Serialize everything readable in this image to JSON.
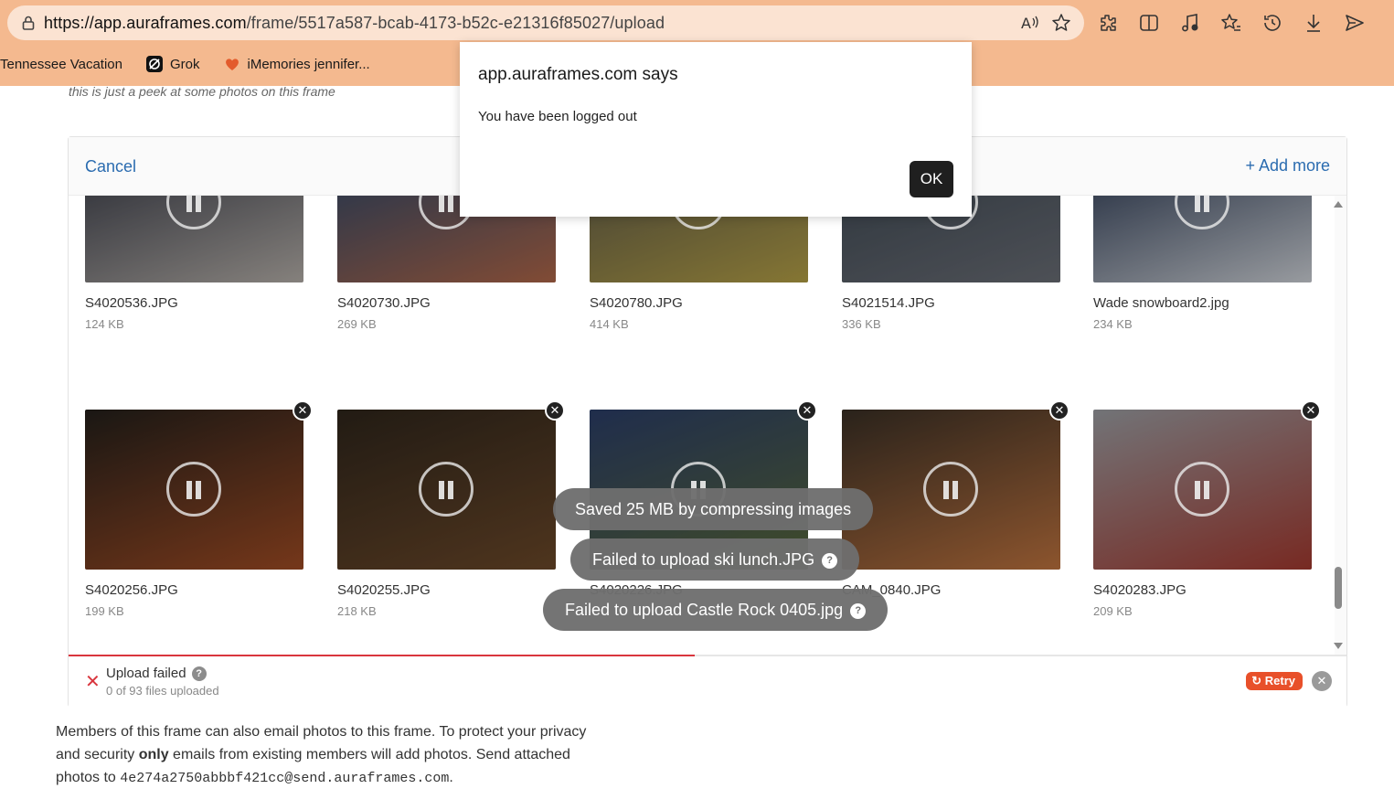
{
  "browser": {
    "url_host": "https://app.auraframes.com",
    "url_path": "/frame/5517a587-bcab-4173-b52c-e21316f85027/upload",
    "bookmarks": [
      {
        "label": "Tennessee Vacation"
      },
      {
        "label": "Grok"
      },
      {
        "label": "iMemories jennifer..."
      }
    ]
  },
  "page": {
    "peek_text": "this is just a peek at some photos on this frame"
  },
  "uploader": {
    "cancel_label": "Cancel",
    "add_more_label": "+ Add more",
    "rows": [
      [
        {
          "name": "S4020536.JPG",
          "size": "124 KB",
          "colors": [
            "#3b3e4a",
            "#b9b3ad"
          ]
        },
        {
          "name": "S4020730.JPG",
          "size": "269 KB",
          "colors": [
            "#314a6b",
            "#b4694a"
          ]
        },
        {
          "name": "S4020780.JPG",
          "size": "414 KB",
          "colors": [
            "#5e5a4c",
            "#b9a447"
          ]
        },
        {
          "name": "S4021514.JPG",
          "size": "336 KB",
          "colors": [
            "#3f4a55",
            "#6c7078"
          ]
        },
        {
          "name": "Wade snowboard2.jpg",
          "size": "234 KB",
          "colors": [
            "#2f3d57",
            "#d3d7dd"
          ]
        }
      ],
      [
        {
          "name": "S4020256.JPG",
          "size": "199 KB",
          "colors": [
            "#24201c",
            "#a34d24"
          ]
        },
        {
          "name": "S4020255.JPG",
          "size": "218 KB",
          "colors": [
            "#2f261c",
            "#6e4a2a"
          ]
        },
        {
          "name": "S4020226.JPG",
          "size": "",
          "colors": [
            "#2c3f6a",
            "#5a6a3a"
          ]
        },
        {
          "name": "CAM_0840.JPG",
          "size": "",
          "colors": [
            "#3a3026",
            "#c37640"
          ]
        },
        {
          "name": "S4020283.JPG",
          "size": "209 KB",
          "colors": [
            "#9fa1a6",
            "#a63a30"
          ]
        }
      ]
    ],
    "progress_fraction": 0.49
  },
  "status": {
    "title": "Upload failed",
    "subtitle": "0 of 93 files uploaded",
    "retry_label": "Retry"
  },
  "footer": {
    "line1": "Members of this frame can also email photos to this frame. To protect your privacy",
    "line2_a": "and security ",
    "line2_bold": "only",
    "line2_b": " emails from existing members will add photos. Send attached",
    "line3_a": "photos to ",
    "email": "4e274a2750abbbf421cc@send.auraframes.com",
    "line3_b": "."
  },
  "dialog": {
    "title": "app.auraframes.com says",
    "message": "You have been logged out",
    "ok_label": "OK"
  },
  "toasts": [
    {
      "text": "Saved 25 MB by compressing images",
      "help": false
    },
    {
      "text": "Failed to upload ski lunch.JPG",
      "help": true
    },
    {
      "text": "Failed to upload Castle Rock 0405.jpg",
      "help": true
    }
  ],
  "colors": {
    "chrome_bg": "#f4b98f",
    "link_blue": "#2b6cb0",
    "error_red": "#d9363e",
    "retry_orange": "#e8502a"
  }
}
